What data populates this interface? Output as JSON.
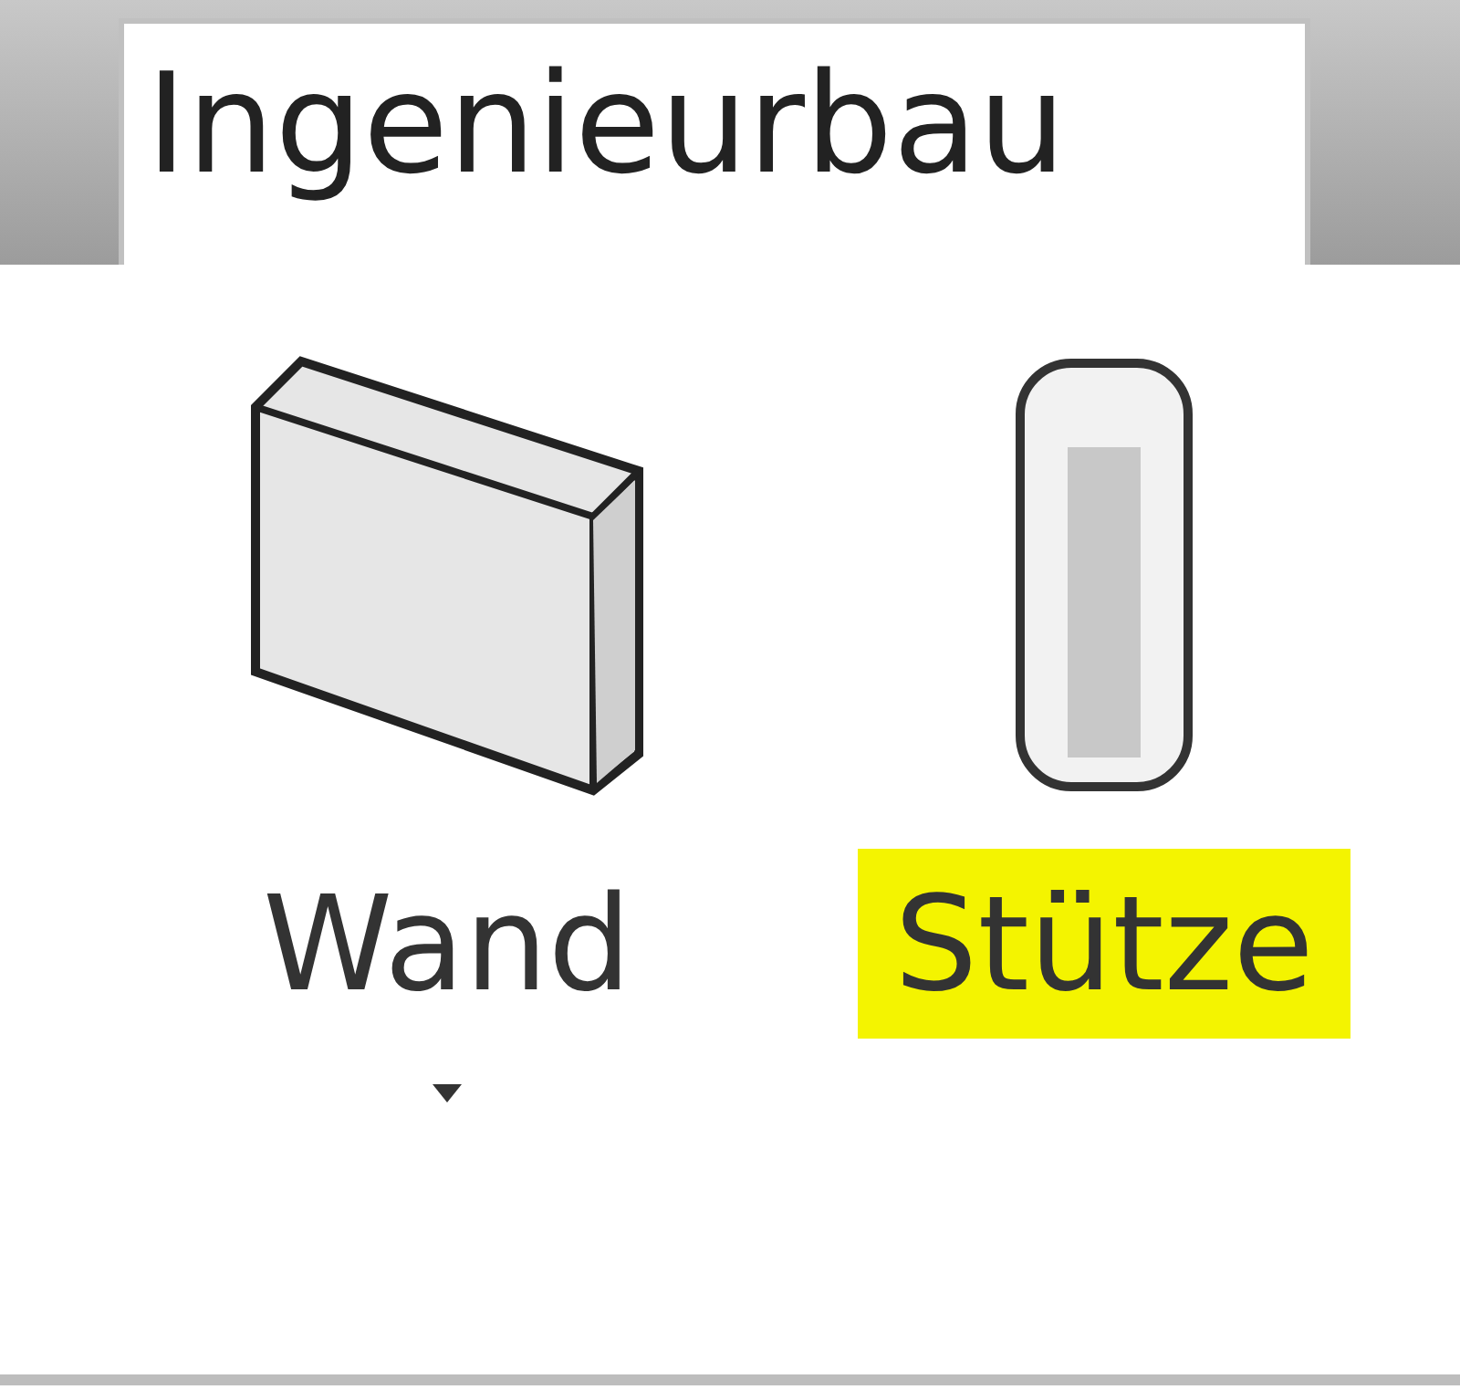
{
  "tab": {
    "label": "Ingenieurbau",
    "selected": true
  },
  "tools": [
    {
      "label": "Wand",
      "kind": "dropdown",
      "highlighted": false
    },
    {
      "label": "Stütze",
      "kind": "button",
      "highlighted": true
    }
  ]
}
